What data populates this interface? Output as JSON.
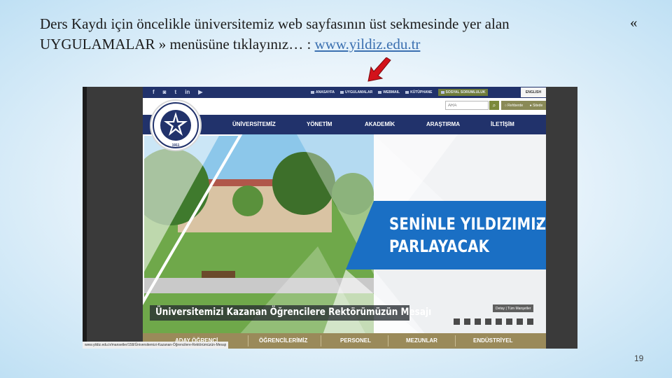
{
  "slide": {
    "instruction_line1": "Ders Kaydı için öncelikle üniversitemiz web sayfasının üst sekmesinde yer alan",
    "instruction_line2": "UYGULAMALAR » menüsüne tıklayınız… : ",
    "link": "www.yildiz.edu.tr",
    "quote_mark": "«",
    "page_number": "19",
    "arrow_color": "#d3121b"
  },
  "site": {
    "social": [
      "f",
      "◙",
      "t",
      "in",
      "▶"
    ],
    "quick_links": [
      {
        "label": "ANASAYFA",
        "icon": "home-icon"
      },
      {
        "label": "UYGULAMALAR",
        "icon": "apps-icon"
      },
      {
        "label": "WEBMAIL",
        "icon": "mail-icon"
      },
      {
        "label": "KÜTÜPHANE",
        "icon": "library-icon"
      },
      {
        "label": "SOSYAL SORUMLULUK",
        "icon": "social-icon"
      }
    ],
    "english": "ENGLISH",
    "search_placeholder": "ARA",
    "radio_1": "Rehberde",
    "radio_2": "Sitede",
    "nav": [
      "ÜNİVERSİTEMİZ",
      "YÖNETİM",
      "AKADEMİK",
      "ARAŞTIRMA",
      "İLETİŞİM"
    ],
    "logo_year": "1911",
    "banner_line1": "SENİNLE YILDIZIMIZ",
    "banner_line2": "PARLAYACAK",
    "caption": "Üniversitemizi Kazanan Öğrencilere Rektörümüzün Mesajı",
    "more": "Detay | Tüm Manşetler",
    "bottom_nav": [
      "ADAY ÖĞRENCİ",
      "ÖĞRENCİLERİMİZ",
      "PERSONEL",
      "MEZUNLAR",
      "ENDÜSTRİYEL"
    ],
    "status_url": "www.yildiz.edu.tr/mansetler/158/Üniversitemizi-Kazanan-Öğrencilere-Rektörümüzün-Mesajı",
    "colors": {
      "navy": "#21326b",
      "olive": "#9a8a5a",
      "blue_banner": "#1a6fc4"
    }
  }
}
